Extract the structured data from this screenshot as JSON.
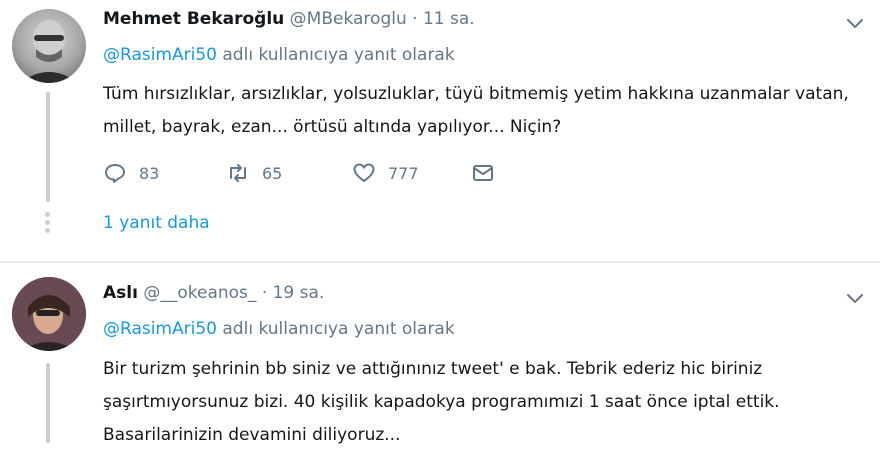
{
  "tweets": [
    {
      "name": "Mehmet Bekaroğlu",
      "handle": "@MBekaroglu",
      "time": "· 11 sa.",
      "reply_mention": "@RasimAri50",
      "reply_suffix": " adlı kullanıcıya yanıt olarak",
      "text": "Tüm hırsızlıklar, arsızlıklar, yolsuzluklar, tüyü bitmemiş yetim hakkına uzanmalar vatan, millet, bayrak, ezan... örtüsü altında yapılıyor... Niçin?",
      "replies": "83",
      "retweets": "65",
      "likes": "777",
      "more_replies": "1 yanıt daha"
    },
    {
      "name": "Aslı",
      "handle": "@__okeanos_",
      "time": "· 19 sa.",
      "reply_mention": "@RasimAri50",
      "reply_suffix": " adlı kullanıcıya yanıt olarak",
      "text": "Bir turizm şehrinin bb siniz ve attığınınız  tweet' e bak. Tebrik ederiz hic biriniz şaşırtmıyorsunuz bizi. 40 kişilik kapadokya programımızi 1 saat önce iptal ettik. Basarilarinizin devamini diliyoruz..."
    }
  ],
  "colors": {
    "link": "#1b95e0",
    "muted": "#657786",
    "text": "#14171a"
  },
  "icons": [
    "reply-icon",
    "retweet-icon",
    "like-icon",
    "message-icon",
    "chevron-down-icon"
  ]
}
